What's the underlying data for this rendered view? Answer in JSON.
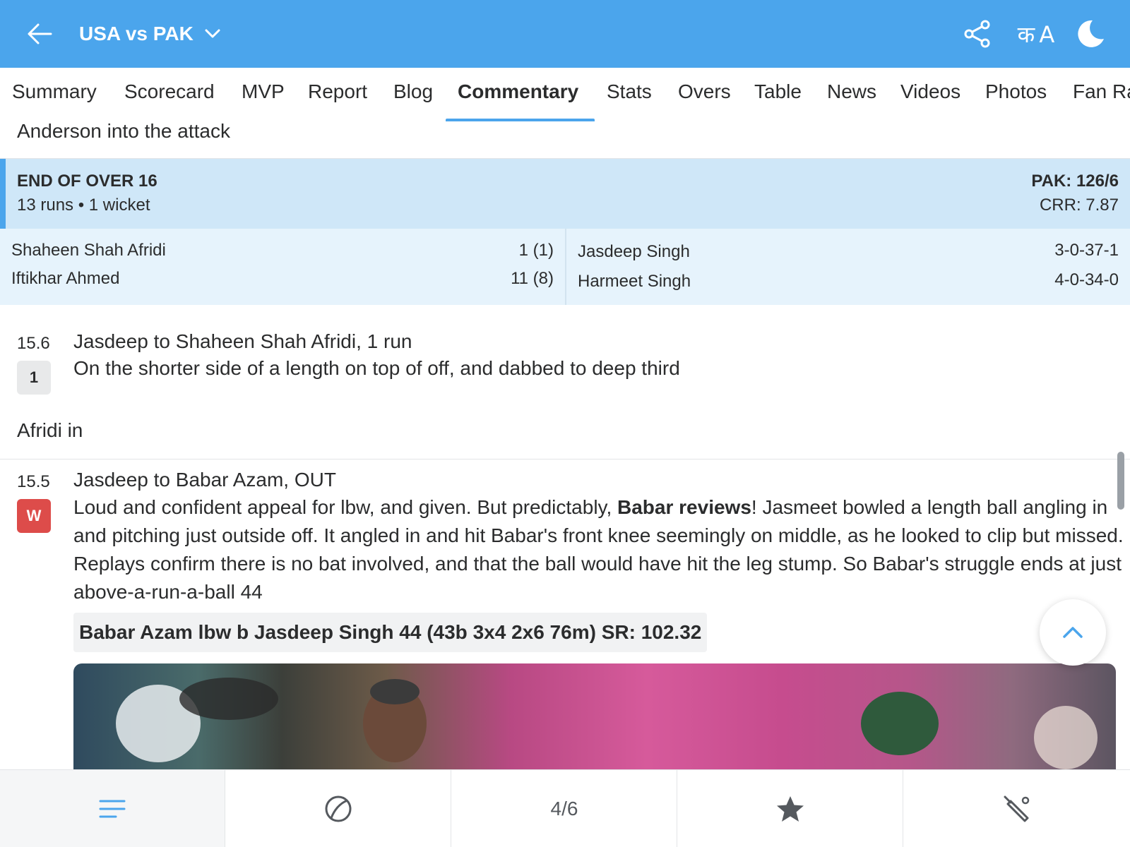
{
  "header": {
    "title": "USA vs PAK",
    "lang_label": "क A"
  },
  "tabs": [
    {
      "label": "Summary",
      "active": false
    },
    {
      "label": "Scorecard",
      "active": false
    },
    {
      "label": "MVP",
      "active": false
    },
    {
      "label": "Report",
      "active": false
    },
    {
      "label": "Blog",
      "active": false
    },
    {
      "label": "Commentary",
      "active": true
    },
    {
      "label": "Stats",
      "active": false
    },
    {
      "label": "Overs",
      "active": false
    },
    {
      "label": "Table",
      "active": false
    },
    {
      "label": "News",
      "active": false
    },
    {
      "label": "Videos",
      "active": false
    },
    {
      "label": "Photos",
      "active": false
    },
    {
      "label": "Fan Ra",
      "active": false
    }
  ],
  "subhead": "Anderson into the attack",
  "over_summary": {
    "title": "END OF OVER 16",
    "detail": "13 runs • 1 wicket",
    "score": "PAK: 126/6",
    "crr": "CRR: 7.87",
    "batters": [
      {
        "name": "Shaheen Shah Afridi",
        "score": "1 (1)"
      },
      {
        "name": "Iftikhar Ahmed",
        "score": "11 (8)"
      }
    ],
    "bowlers": [
      {
        "name": "Jasdeep Singh",
        "figures": "3-0-37-1"
      },
      {
        "name": "Harmeet Singh",
        "figures": "4-0-34-0"
      }
    ]
  },
  "commentary": [
    {
      "ball": "15.6",
      "badge": "1",
      "headline": "Jasdeep to Shaheen Shah Afridi, 1 run",
      "text": "On the shorter side of a length on top of off, and dabbed to deep third"
    },
    {
      "note": "Afridi in"
    },
    {
      "ball": "15.5",
      "badge": "W",
      "headline": "Jasdeep to Babar Azam, OUT",
      "text_before": "Loud and confident appeal for lbw, and given. But predictably, ",
      "text_bold": "Babar reviews",
      "text_after": "! Jasmeet bowled a length ball angling in and pitching just outside off. It angled in and hit Babar's front knee seemingly on middle, as he looked to clip but missed. Replays confirm there is no bat involved, and that the ball would have hit the leg stump. So Babar's struggle ends at just above-a-run-a-ball 44",
      "dismissal": "Babar Azam lbw b Jasdeep Singh 44 (43b 3x4 2x6 76m) SR: 102.32"
    }
  ],
  "bottom_nav": {
    "page_indicator": "4/6",
    "icons": [
      "menu-icon",
      "ball-icon",
      "page-indicator",
      "star-icon",
      "bat-icon"
    ]
  },
  "colors": {
    "brand": "#4ba5ec",
    "over_bg": "#cfe7f8",
    "players_bg": "#e6f3fc",
    "wicket": "#dd4c4a"
  }
}
